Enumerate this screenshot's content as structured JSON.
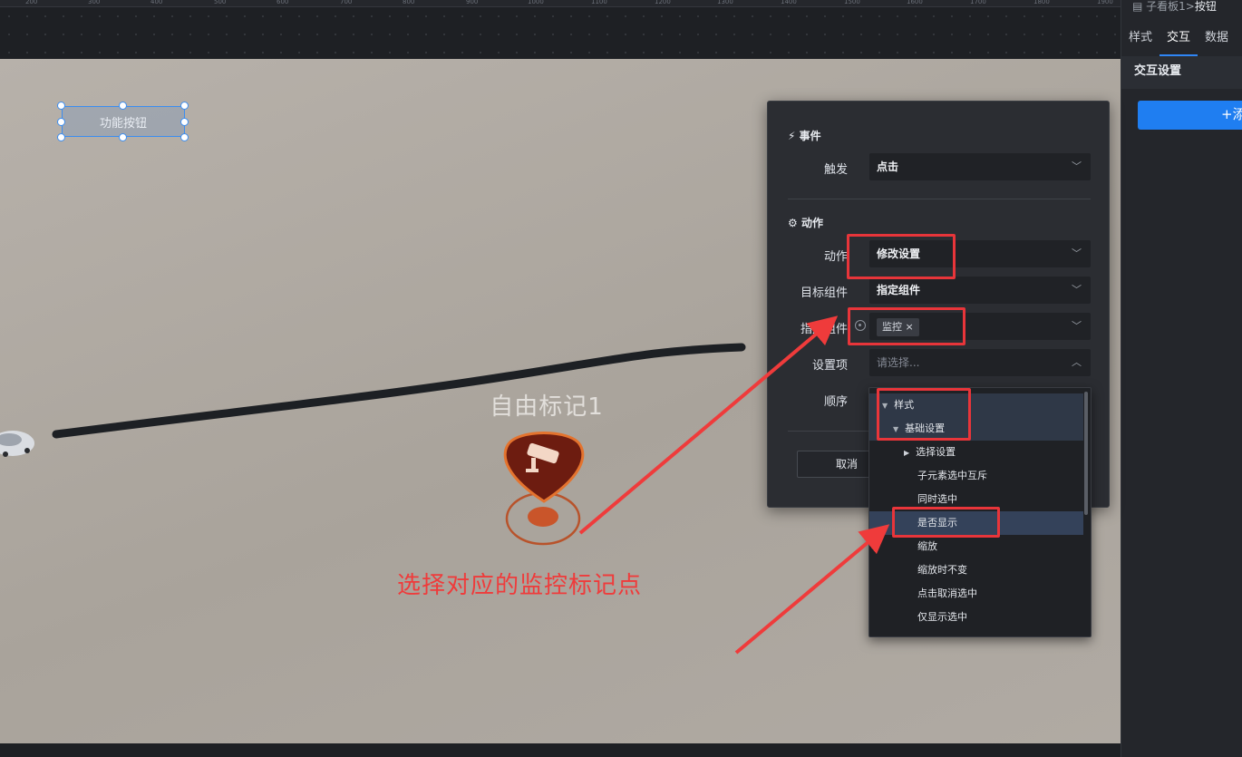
{
  "ruler": {
    "ticks": [
      "200",
      "300",
      "400",
      "500",
      "600",
      "700",
      "800",
      "900",
      "1000",
      "1100",
      "1200",
      "1300",
      "1400",
      "1500",
      "1600",
      "1700",
      "1800",
      "1900"
    ]
  },
  "canvas": {
    "function_button_label": "功能按钮",
    "marker_title": "自由标记1",
    "annotation_text": "选择对应的监控标记点"
  },
  "right_panel": {
    "breadcrumb_prefix": "子看板1",
    "breadcrumb_sep": ">",
    "breadcrumb_current": "按钮",
    "tabs": [
      {
        "label": "样式"
      },
      {
        "label": "交互"
      },
      {
        "label": "数据"
      }
    ],
    "active_tab": "交互",
    "section_title": "交互设置",
    "add_label": "+添"
  },
  "dialog": {
    "event_section": "事件",
    "trigger_label": "触发",
    "trigger_value": "点击",
    "action_section": "动作",
    "action_label": "动作",
    "action_value": "修改设置",
    "target_label": "目标组件",
    "target_value": "指定组件",
    "specify_label": "指定组件",
    "specify_tag": "监控",
    "settings_label": "设置项",
    "settings_placeholder": "请选择...",
    "order_label": "顺序",
    "cancel_label": "取消"
  },
  "dropdown": {
    "items": [
      {
        "label": "样式"
      },
      {
        "label": "基础设置"
      },
      {
        "label": "选择设置"
      },
      {
        "label": "子元素选中互斥"
      },
      {
        "label": "同时选中"
      },
      {
        "label": "是否显示"
      },
      {
        "label": "缩放"
      },
      {
        "label": "缩放时不变"
      },
      {
        "label": "点击取消选中"
      },
      {
        "label": "仅显示选中"
      }
    ]
  },
  "colors": {
    "accent": "#2f86f6",
    "annotation_red": "#ef3b3b",
    "marker": "#c4501f"
  }
}
